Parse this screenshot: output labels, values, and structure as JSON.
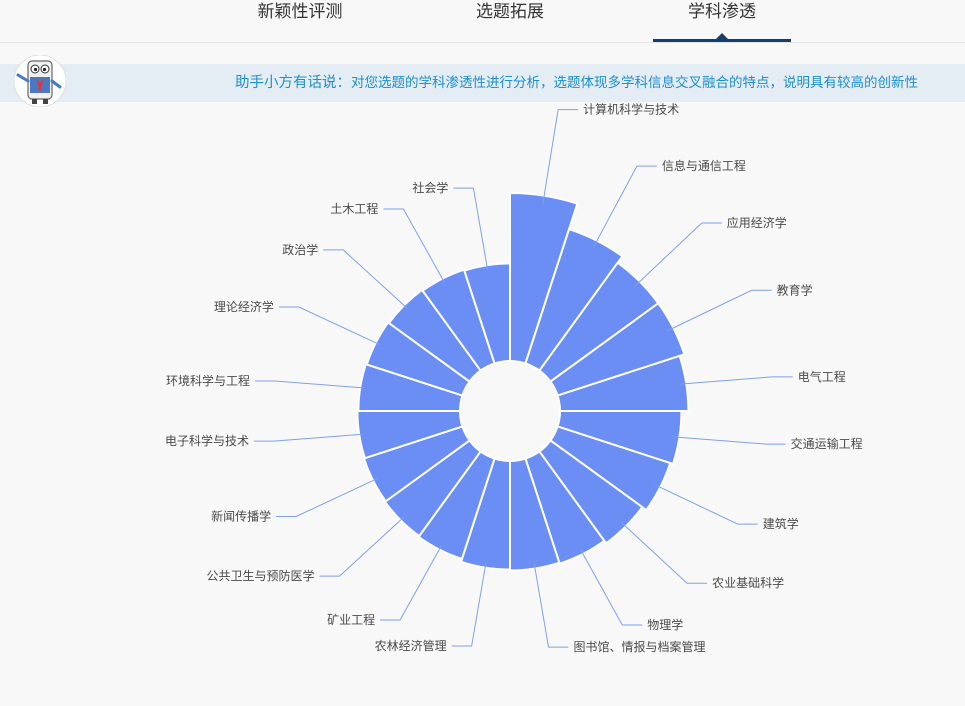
{
  "tabs": [
    {
      "label": "新颖性评测",
      "active": false
    },
    {
      "label": "选题拓展",
      "active": false
    },
    {
      "label": "学科渗透",
      "active": true
    }
  ],
  "assistant": {
    "prefix": "助手小方有话说：",
    "message": "对您选题的学科渗透性进行分析，选题体现多学科信息交叉融合的特点，说明具有较高的创新性"
  },
  "colors": {
    "accent": "#1a3e6b",
    "segment": "#6a8ef4",
    "label_line": "#7fa0ea",
    "assistant_text": "#1b8fd0"
  },
  "chart_data": {
    "type": "pie",
    "subtype": "rose",
    "categories": [
      "计算机科学与技术",
      "信息与通信工程",
      "应用经济学",
      "教育学",
      "电气工程",
      "交通运输工程",
      "建筑学",
      "农业基础科学",
      "物理学",
      "图书馆、情报与档案管理",
      "农林经济管理",
      "矿业工程",
      "公共卫生与预防医学",
      "新闻传播学",
      "电子科学与技术",
      "环境科学与工程",
      "理论经济学",
      "政治学",
      "土木工程",
      "社会学"
    ],
    "values": [
      220,
      193,
      185,
      185,
      180,
      173,
      170,
      165,
      162,
      161,
      160,
      157,
      156,
      155,
      154,
      153,
      152,
      151,
      150,
      149
    ]
  }
}
